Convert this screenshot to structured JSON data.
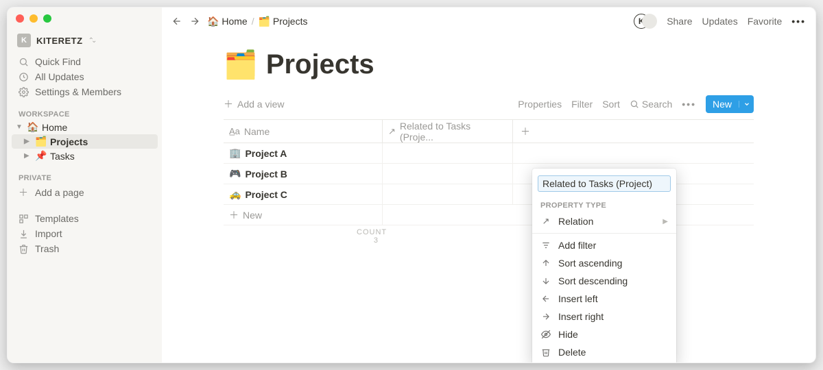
{
  "workspace": {
    "initial": "K",
    "name": "KITERETZ"
  },
  "sidebar": {
    "quick_find": "Quick Find",
    "all_updates": "All Updates",
    "settings": "Settings & Members",
    "section_workspace": "WORKSPACE",
    "section_private": "PRIVATE",
    "tree": [
      {
        "emoji": "🏠",
        "label": "Home",
        "level": 0,
        "expanded": true,
        "selected": false
      },
      {
        "emoji": "🗂️",
        "label": "Projects",
        "level": 1,
        "expanded": false,
        "selected": true
      },
      {
        "emoji": "📌",
        "label": "Tasks",
        "level": 1,
        "expanded": false,
        "selected": false
      }
    ],
    "add_page": "Add a page",
    "templates": "Templates",
    "import": "Import",
    "trash": "Trash"
  },
  "topbar": {
    "crumbs": [
      {
        "emoji": "🏠",
        "label": "Home"
      },
      {
        "emoji": "🗂️",
        "label": "Projects"
      }
    ],
    "user_initial": "K",
    "share": "Share",
    "updates": "Updates",
    "favorite": "Favorite"
  },
  "page": {
    "emoji": "🗂️",
    "title": "Projects",
    "add_view": "Add a view",
    "toolbar": {
      "properties": "Properties",
      "filter": "Filter",
      "sort": "Sort",
      "search": "Search",
      "new": "New"
    },
    "table": {
      "columns": [
        {
          "icon": "text",
          "label": "Name"
        },
        {
          "icon": "relation",
          "label": "Related to Tasks (Proje..."
        }
      ],
      "rows": [
        {
          "emoji": "🏢",
          "label": "Project A"
        },
        {
          "emoji": "🎮",
          "label": "Project B"
        },
        {
          "emoji": "🚕",
          "label": "Project C"
        }
      ],
      "new_row": "New",
      "count_label": "COUNT",
      "count_value": "3"
    }
  },
  "popover": {
    "input_value": "Related to Tasks (Project)",
    "section_type": "PROPERTY TYPE",
    "type_item": "Relation",
    "items": [
      {
        "icon": "filter",
        "label": "Add filter"
      },
      {
        "icon": "asc",
        "label": "Sort ascending"
      },
      {
        "icon": "desc",
        "label": "Sort descending"
      },
      {
        "icon": "left",
        "label": "Insert left"
      },
      {
        "icon": "right",
        "label": "Insert right"
      },
      {
        "icon": "hide",
        "label": "Hide"
      },
      {
        "icon": "delete",
        "label": "Delete"
      }
    ]
  }
}
